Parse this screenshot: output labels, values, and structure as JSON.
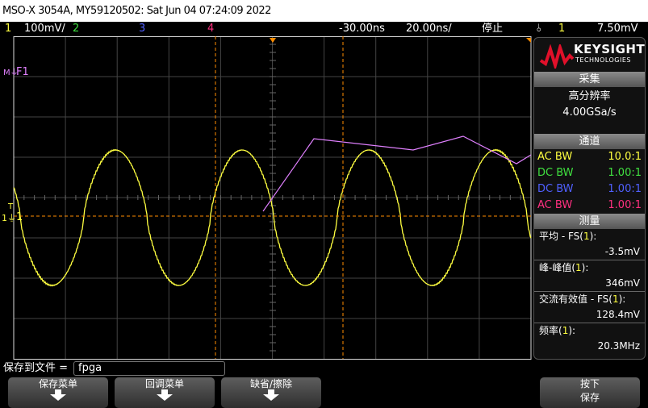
{
  "title": "MSO-X 3054A, MY59120502: Sat Jun 04 07:24:09 2022",
  "status": {
    "ch1": "1",
    "ch1_scale": "100mV/",
    "ch2": "2",
    "ch3": "3",
    "ch4": "4",
    "delay": "-30.00ns",
    "timebase": "20.00ns/",
    "run_state": "停止",
    "trigger_icon": "trigger-edge-icon",
    "trigger_src": "1",
    "trigger_level": "7.50mV"
  },
  "markers": {
    "math": "F1",
    "ch1": "1",
    "trigger": "T"
  },
  "colors": {
    "ch1": "#ffff40",
    "ch2": "#40e040",
    "ch3": "#5060ff",
    "ch4": "#ff3080",
    "math": "#e080ff",
    "cursor": "#ff8c00"
  },
  "panel": {
    "logo_main": "KEYSIGHT",
    "logo_sub": "TECHNOLOGIES",
    "acq_header": "采集",
    "acq_mode": "高分辨率",
    "acq_rate": "4.00GSa/s",
    "ch_header": "通道",
    "channels": [
      {
        "coupling": "AC BW",
        "probe": "10.0:1"
      },
      {
        "coupling": "DC BW",
        "probe": "1.00:1"
      },
      {
        "coupling": "DC BW",
        "probe": "1.00:1"
      },
      {
        "coupling": "AC BW",
        "probe": "1.00:1"
      }
    ],
    "meas_header": "测量",
    "measurements": [
      {
        "pre": "平均 - FS(",
        "src": "1",
        "post": "):",
        "value": "-3.5mV"
      },
      {
        "pre": "峰-峰值(",
        "src": "1",
        "post": "):",
        "value": "346mV"
      },
      {
        "pre": "交流有效值 - FS(",
        "src": "1",
        "post": "):",
        "value": "128.4mV"
      },
      {
        "pre": "频率(",
        "src": "1",
        "post": "):",
        "value": "20.3MHz"
      }
    ]
  },
  "save": {
    "label": "保存到文件 =",
    "filename": "fpga"
  },
  "softkeys": [
    {
      "label": "保存菜单"
    },
    {
      "label": "回调菜单"
    },
    {
      "label": "缺省/擦除"
    },
    {
      "label1": "按下",
      "label2": "保存"
    }
  ]
}
